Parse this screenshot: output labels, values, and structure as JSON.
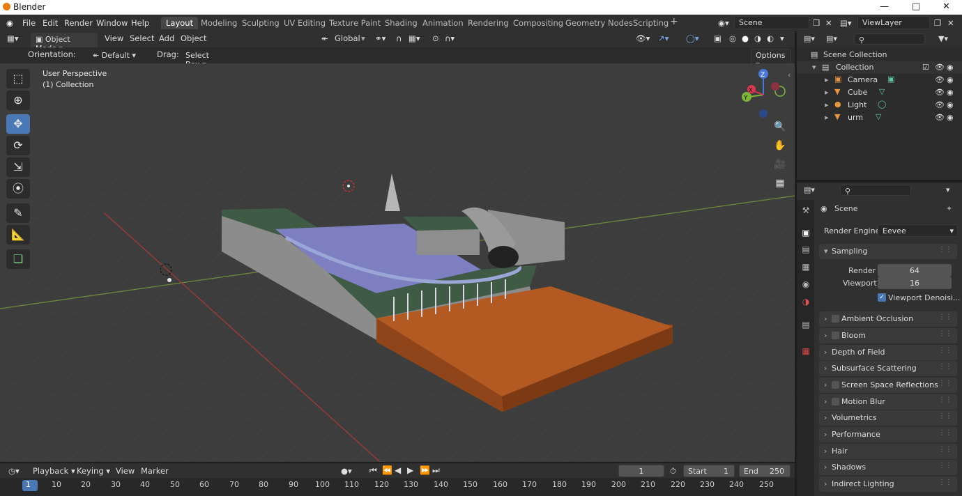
{
  "app": {
    "title": "Blender"
  },
  "menu": {
    "items": [
      "File",
      "Edit",
      "Render",
      "Window",
      "Help"
    ]
  },
  "workspaces": [
    "Layout",
    "Modeling",
    "Sculpting",
    "UV Editing",
    "Texture Paint",
    "Shading",
    "Animation",
    "Rendering",
    "Compositing",
    "Geometry Nodes",
    "Scripting"
  ],
  "scene": {
    "name": "Scene",
    "view_layer": "ViewLayer"
  },
  "header": {
    "mode": "Object Mode",
    "menus": [
      "View",
      "Select",
      "Add",
      "Object"
    ],
    "transform": "Global"
  },
  "subheader": {
    "orientation_label": "Orientation:",
    "orientation_value": "Default",
    "drag_label": "Drag:",
    "drag_value": "Select Box",
    "options": "Options"
  },
  "viewport": {
    "perspective": "User Perspective",
    "collection": "(1) Collection",
    "gizmo_axes": [
      "Z",
      "Y",
      "X"
    ]
  },
  "outliner": {
    "root": "Scene Collection",
    "collection": "Collection",
    "items": [
      {
        "name": "Camera",
        "icon": "camera-icon"
      },
      {
        "name": "Cube",
        "icon": "mesh-icon"
      },
      {
        "name": "Light",
        "icon": "light-icon"
      },
      {
        "name": "urm",
        "icon": "mesh-icon"
      }
    ]
  },
  "properties": {
    "title": "Scene",
    "render_engine_label": "Render Engine",
    "render_engine": "Eevee",
    "sampling": "Sampling",
    "render_label": "Render",
    "render_value": "64",
    "viewport_label": "Viewport",
    "viewport_value": "16",
    "viewport_denoise": "Viewport Denoisi...",
    "panels": [
      {
        "label": "Ambient Occlusion",
        "checkbox": true
      },
      {
        "label": "Bloom",
        "checkbox": true
      },
      {
        "label": "Depth of Field",
        "checkbox": false
      },
      {
        "label": "Subsurface Scattering",
        "checkbox": false
      },
      {
        "label": "Screen Space Reflections",
        "checkbox": true
      },
      {
        "label": "Motion Blur",
        "checkbox": true
      },
      {
        "label": "Volumetrics",
        "checkbox": false
      },
      {
        "label": "Performance",
        "checkbox": false
      },
      {
        "label": "Hair",
        "checkbox": false
      },
      {
        "label": "Shadows",
        "checkbox": false
      },
      {
        "label": "Indirect Lighting",
        "checkbox": false
      }
    ]
  },
  "timeline": {
    "menus": [
      "Playback",
      "Keying",
      "View",
      "Marker"
    ],
    "current_frame": "1",
    "start_label": "Start",
    "start": "1",
    "end_label": "End",
    "end": "250",
    "ticks": [
      "1",
      "10",
      "20",
      "30",
      "40",
      "50",
      "60",
      "70",
      "80",
      "90",
      "100",
      "110",
      "120",
      "130",
      "140",
      "150",
      "160",
      "170",
      "180",
      "190",
      "200",
      "210",
      "220",
      "230",
      "240",
      "250"
    ]
  },
  "colors": {
    "accent": "#4a77b5",
    "terrain_orange": "#b35a22",
    "water": "#7d7fc0",
    "grass": "#3f5b46"
  }
}
